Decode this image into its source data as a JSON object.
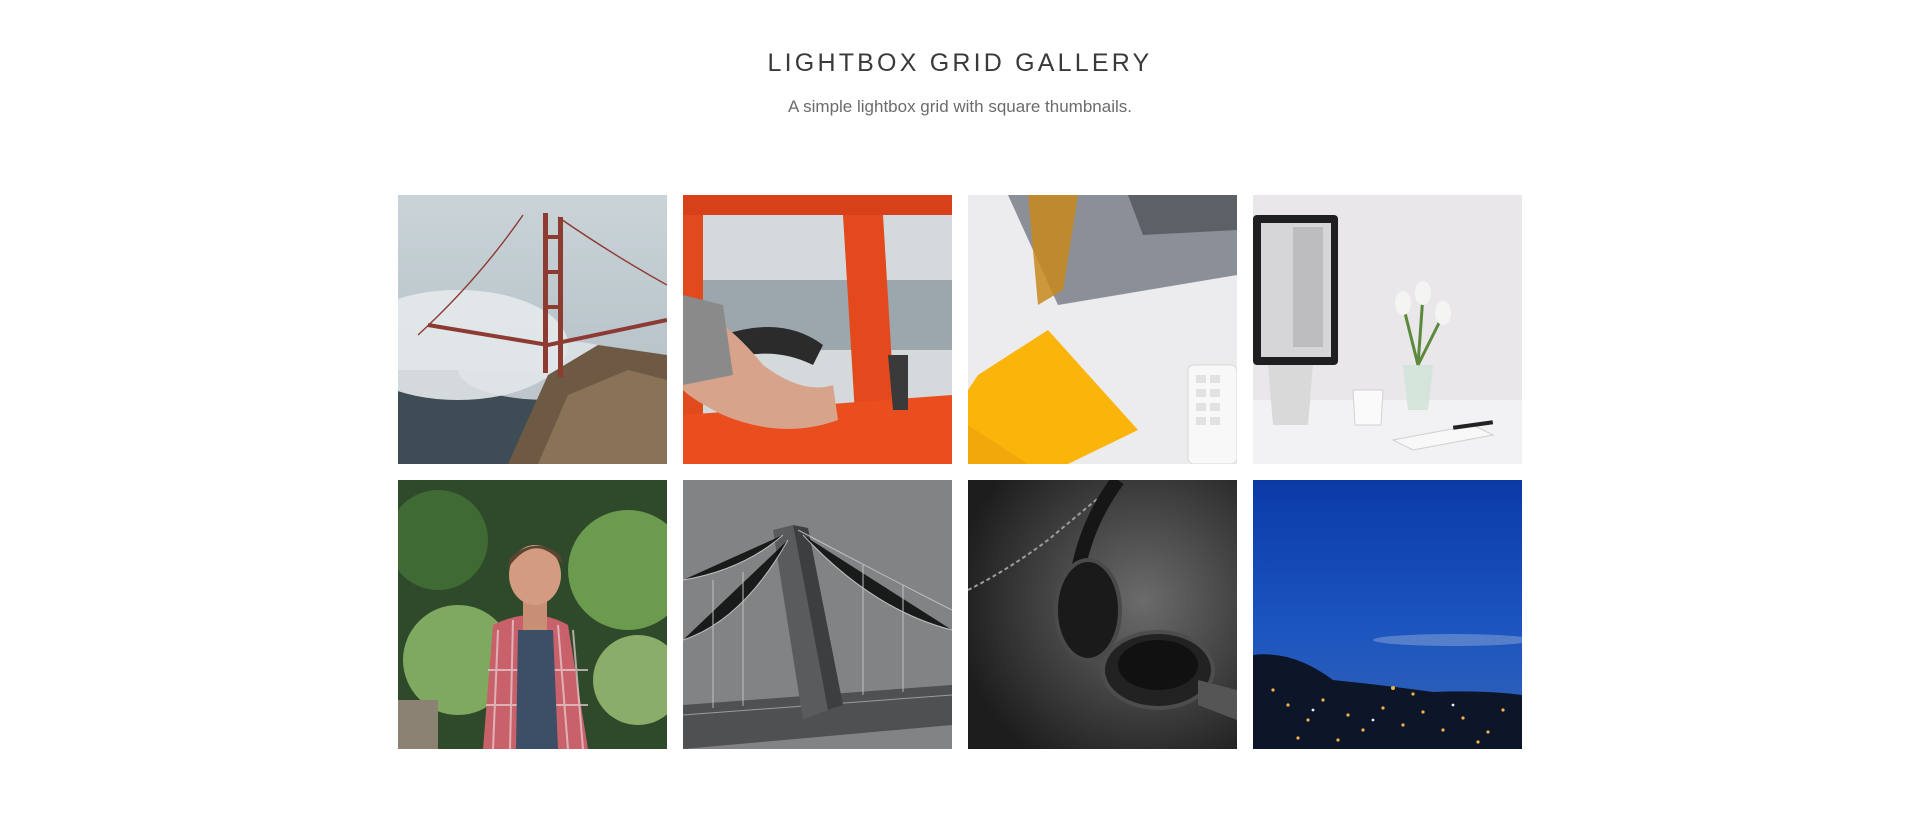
{
  "header": {
    "title": "LIGHTBOX GRID GALLERY",
    "subtitle": "A simple lightbox grid with square thumbnails."
  },
  "gallery": {
    "thumbnails": [
      {
        "subject": "golden-gate-bridge-fog-photo"
      },
      {
        "subject": "orange-van-driver-arm-photo"
      },
      {
        "subject": "desk-yellow-notebook-keyboard-photo"
      },
      {
        "subject": "white-desk-monitor-tulips-photo"
      },
      {
        "subject": "man-plaid-shirt-forest-photo"
      },
      {
        "subject": "bridge-tower-aerial-bw-photo"
      },
      {
        "subject": "headphones-bw-photo"
      },
      {
        "subject": "night-city-blue-sky-photo"
      }
    ]
  }
}
